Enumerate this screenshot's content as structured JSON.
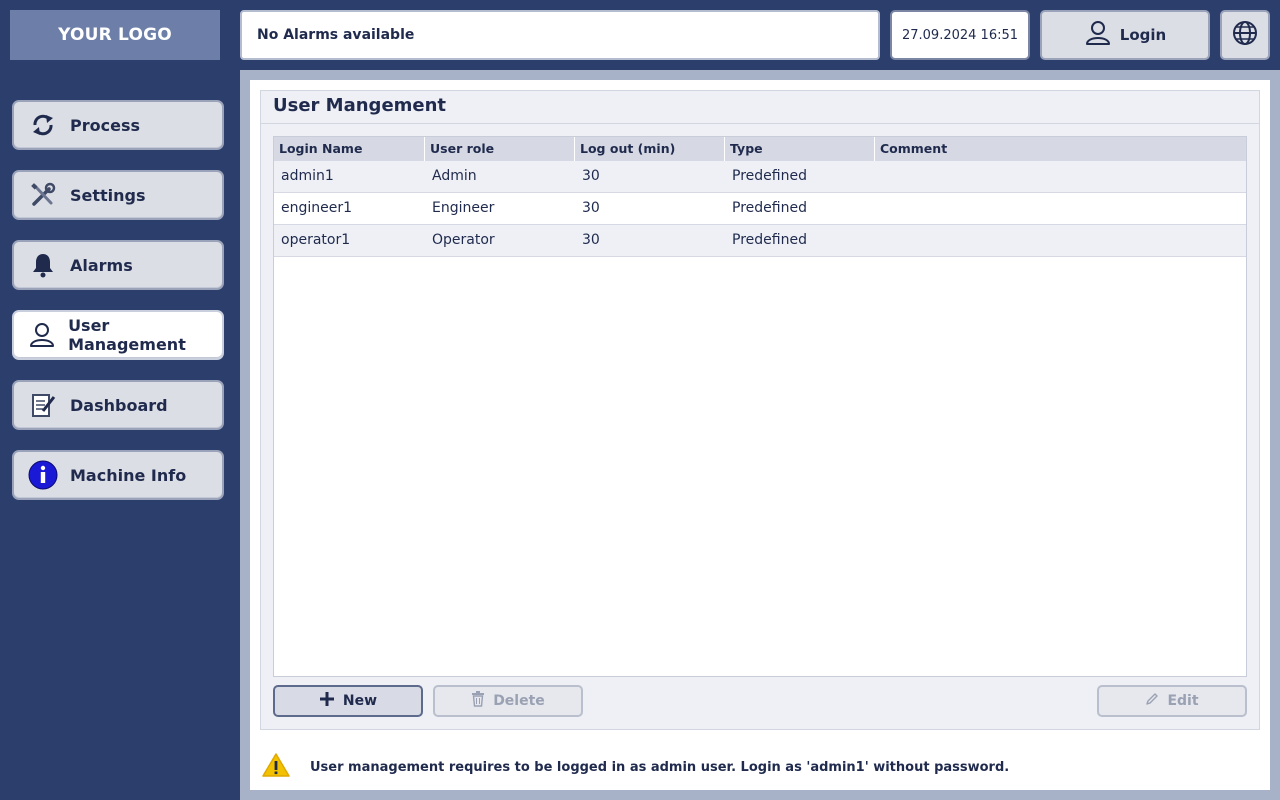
{
  "header": {
    "logo_text": "YOUR LOGO",
    "alarm_text": "No Alarms available",
    "datetime": "27.09.2024 16:51",
    "login_label": "Login"
  },
  "sidebar": {
    "items": [
      {
        "label": "Process",
        "icon": "refresh-icon",
        "active": false
      },
      {
        "label": "Settings",
        "icon": "tools-icon",
        "active": false
      },
      {
        "label": "Alarms",
        "icon": "bell-icon",
        "active": false
      },
      {
        "label": "User Management",
        "icon": "user-icon",
        "active": true
      },
      {
        "label": "Dashboard",
        "icon": "clipboard-icon",
        "active": false
      },
      {
        "label": "Machine Info",
        "icon": "info-icon",
        "active": false
      }
    ]
  },
  "main": {
    "title": "User Mangement",
    "table": {
      "columns": [
        "Login Name",
        "User role",
        "Log out (min)",
        "Type",
        "Comment"
      ],
      "rows": [
        [
          "admin1",
          "Admin",
          "30",
          "Predefined",
          ""
        ],
        [
          "engineer1",
          "Engineer",
          "30",
          "Predefined",
          ""
        ],
        [
          "operator1",
          "Operator",
          "30",
          "Predefined",
          ""
        ]
      ]
    },
    "buttons": {
      "new_label": "New",
      "delete_label": "Delete",
      "edit_label": "Edit"
    },
    "warning_text": "User management requires to be logged in as admin user. Login as 'admin1' without password."
  },
  "colors": {
    "background": "#2c3e6b",
    "logo_bg": "#6d7fa8",
    "button_bg": "#dcdee6",
    "text_dark": "#1f2a4d",
    "info_blue": "#1a1ad6",
    "warning_yellow": "#f2c200"
  }
}
